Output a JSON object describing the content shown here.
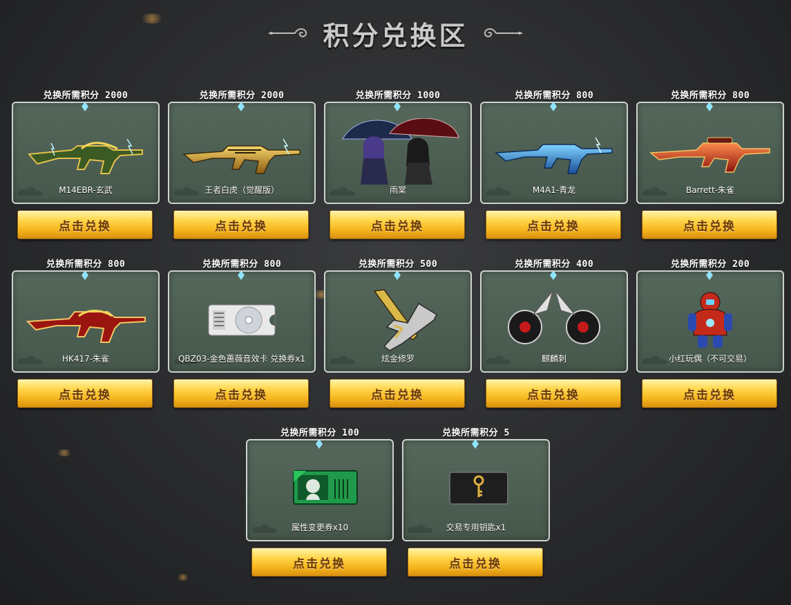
{
  "page": {
    "title": "积分兑换区"
  },
  "items": [
    {
      "cost": "兑换所需积分 2000",
      "name": "M14EBR-玄武",
      "button": "点击兑换",
      "icon": "rifle-green-gold-icon"
    },
    {
      "cost": "兑换所需积分 2000",
      "name": "王者白虎（觉醒版）",
      "button": "点击兑换",
      "icon": "rifle-gold-icon"
    },
    {
      "cost": "兑换所需积分 1000",
      "name": "雨棠",
      "button": "点击兑换",
      "icon": "characters-umbrella-icon"
    },
    {
      "cost": "兑换所需积分 800",
      "name": "M4A1-青龙",
      "button": "点击兑换",
      "icon": "rifle-blue-icon"
    },
    {
      "cost": "兑换所需积分 800",
      "name": "Barrett-朱雀",
      "button": "点击兑换",
      "icon": "sniper-red-gold-icon"
    },
    {
      "cost": "兑换所需积分 800",
      "name": "HK417-朱雀",
      "button": "点击兑换",
      "icon": "rifle-red-gold-icon"
    },
    {
      "cost": "兑换所需积分 800",
      "name": "QBZ03-金色蔷薇音效卡 兑换券x1",
      "button": "点击兑换",
      "icon": "disc-ticket-icon"
    },
    {
      "cost": "兑换所需积分 500",
      "name": "炫金修罗",
      "button": "点击兑换",
      "icon": "pistol-knife-icon"
    },
    {
      "cost": "兑换所需积分 400",
      "name": "麒麟刺",
      "button": "点击兑换",
      "icon": "twin-blades-icon"
    },
    {
      "cost": "兑换所需积分 200",
      "name": "小红玩偶（不可交易）",
      "button": "点击兑换",
      "icon": "red-doll-icon"
    },
    {
      "cost": "兑换所需积分 100",
      "name": "属性变更券x10",
      "button": "点击兑换",
      "icon": "green-ticket-icon"
    },
    {
      "cost": "兑换所需积分 5",
      "name": "交易专用钥匙x1",
      "button": "点击兑换",
      "icon": "key-icon"
    }
  ]
}
